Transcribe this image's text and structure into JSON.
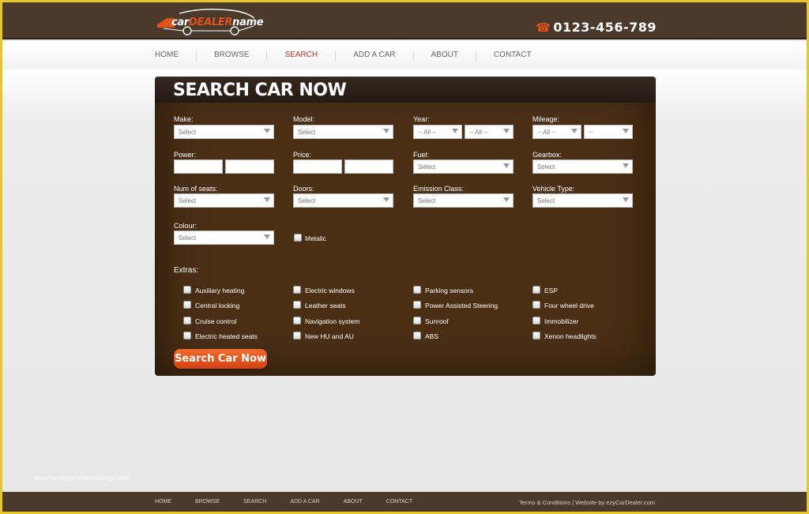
{
  "header": {
    "logo": {
      "part1": "car",
      "part2": "DEALER",
      "part3": "name"
    },
    "phone": "0123-456-789"
  },
  "nav": {
    "items": [
      "HOME",
      "BROWSE",
      "SEARCH",
      "ADD A CAR",
      "ABOUT",
      "CONTACT"
    ],
    "active": "SEARCH"
  },
  "panel": {
    "title": "SEARCH CAR NOW",
    "fields": {
      "make": {
        "label": "Make:",
        "value": "Select"
      },
      "model": {
        "label": "Model:",
        "value": "Select"
      },
      "year": {
        "label": "Year:",
        "from": "-- All --",
        "to": "-- All --"
      },
      "mileage": {
        "label": "Mileage:",
        "from": "-- All --",
        "to": "--"
      },
      "power": {
        "label": "Power:"
      },
      "price": {
        "label": "Price:"
      },
      "fuel": {
        "label": "Fuel:",
        "value": "Select"
      },
      "gearbox": {
        "label": "Gearbox:",
        "value": "Select"
      },
      "seats": {
        "label": "Num of seats:",
        "value": "Select"
      },
      "doors": {
        "label": "Doors:",
        "value": "Select"
      },
      "emission": {
        "label": "Emission Class:",
        "value": "Select"
      },
      "vehicle_type": {
        "label": "Vehicle Type:",
        "value": "Select"
      },
      "colour": {
        "label": "Colour:",
        "value": "Select"
      },
      "metalic": {
        "label": "Metalic"
      }
    },
    "extras_label": "Extras:",
    "extras": [
      [
        "Auxiliary heating",
        "Central locking",
        "Cruise control",
        "Electric heated seats"
      ],
      [
        "Electric windows",
        "Leather seats",
        "Navigation system",
        "New HU and AU"
      ],
      [
        "Parking sensors",
        "Power Assisted Steering",
        "Sunroof",
        "ABS"
      ],
      [
        "ESP",
        "Four wheel drive",
        "Immobilizer",
        "Xenon headlights"
      ]
    ],
    "button": "Search Car Now"
  },
  "watermark": "www.heritagechristiancollege.com",
  "footer": {
    "items": [
      "HOME",
      "BROWSE",
      "SEARCH",
      "ADD A CAR",
      "ABOUT",
      "CONTACT"
    ],
    "terms": "Terms & Conditions",
    "separator": " | ",
    "credit": "Website by ezyCarDealer.com"
  }
}
